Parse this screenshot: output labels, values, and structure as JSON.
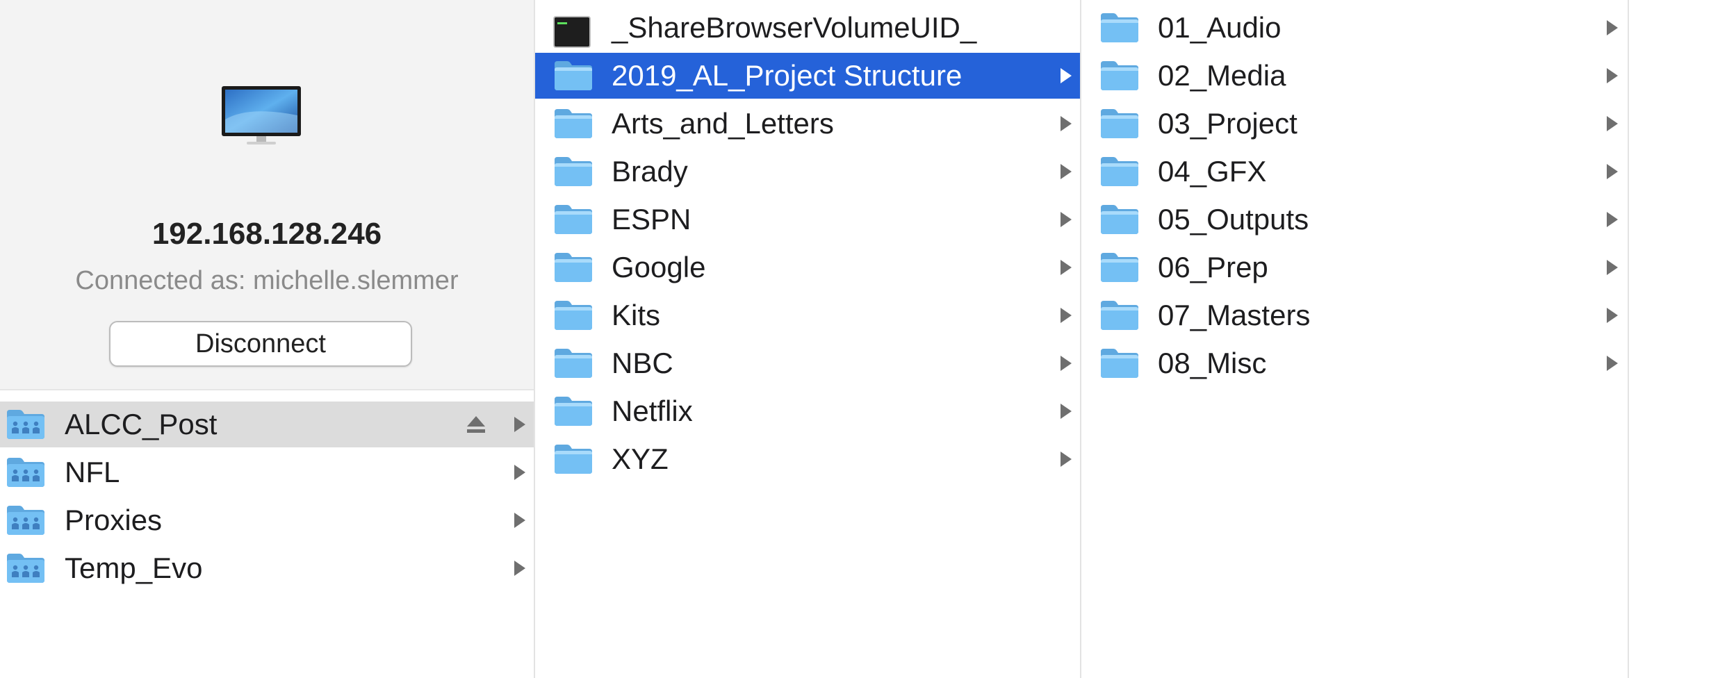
{
  "server": {
    "ip": "192.168.128.246",
    "connected_as": "Connected as: michelle.slemmer",
    "disconnect_label": "Disconnect",
    "icon": "imac-icon"
  },
  "shares": [
    {
      "name": "ALCC_Post",
      "selected": true,
      "eject": true
    },
    {
      "name": "NFL"
    },
    {
      "name": "Proxies"
    },
    {
      "name": "Temp_Evo"
    }
  ],
  "col2_items": [
    {
      "name": "_ShareBrowserVolumeUID_",
      "icon": "terminal-file-icon",
      "has_children": false
    },
    {
      "name": "2019_AL_Project Structure",
      "icon": "folder-icon",
      "has_children": true,
      "selected": true
    },
    {
      "name": "Arts_and_Letters",
      "icon": "folder-icon",
      "has_children": true
    },
    {
      "name": "Brady",
      "icon": "folder-icon",
      "has_children": true
    },
    {
      "name": "ESPN",
      "icon": "folder-icon",
      "has_children": true
    },
    {
      "name": "Google",
      "icon": "folder-icon",
      "has_children": true
    },
    {
      "name": "Kits",
      "icon": "folder-icon",
      "has_children": true
    },
    {
      "name": "NBC",
      "icon": "folder-icon",
      "has_children": true
    },
    {
      "name": "Netflix",
      "icon": "folder-icon",
      "has_children": true
    },
    {
      "name": "XYZ",
      "icon": "folder-icon",
      "has_children": true
    }
  ],
  "col3_items": [
    {
      "name": "01_Audio"
    },
    {
      "name": "02_Media"
    },
    {
      "name": "03_Project"
    },
    {
      "name": "04_GFX"
    },
    {
      "name": "05_Outputs"
    },
    {
      "name": "06_Prep"
    },
    {
      "name": "07_Masters"
    },
    {
      "name": "08_Misc"
    }
  ],
  "colors": {
    "selection_blue": "#2562d9",
    "selection_gray": "#dcdcdc",
    "folder_blue": "#74c0f4",
    "chevron_gray": "#6f6f6f"
  }
}
